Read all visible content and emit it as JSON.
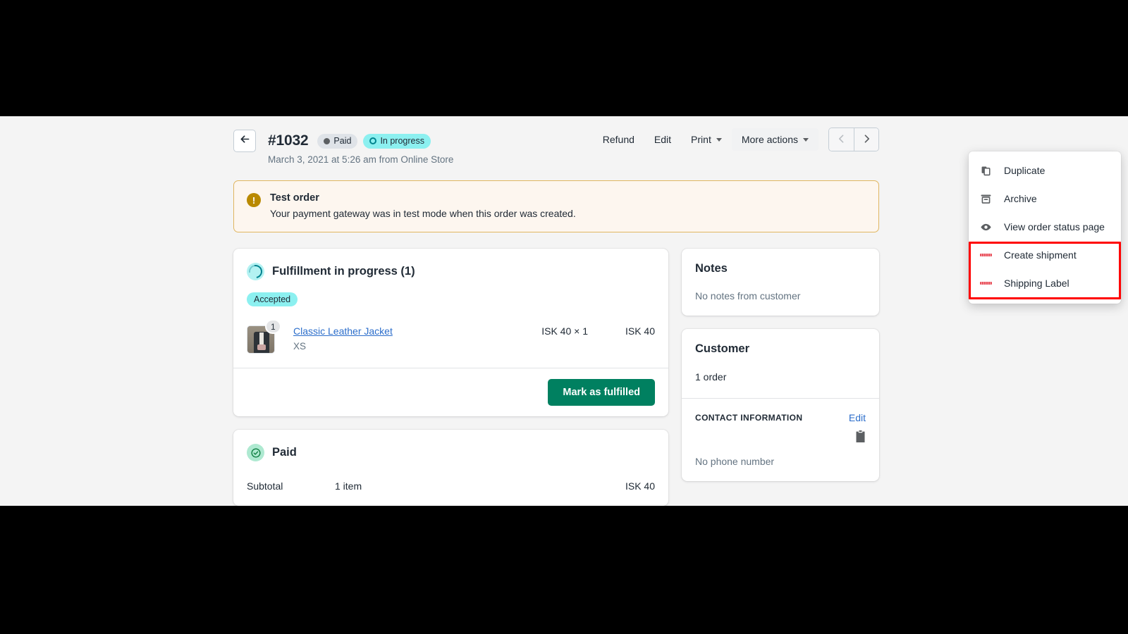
{
  "header": {
    "back_icon": "arrow-left-icon",
    "order_number": "#1032",
    "badges": [
      {
        "label": "Paid",
        "icon": "filled-circle-icon",
        "color": "#dfe3e8"
      },
      {
        "label": "In progress",
        "icon": "partial-ring-icon",
        "color": "#8cf0f0"
      }
    ],
    "date_line": "March 3, 2021 at 5:26 am from Online Store",
    "actions": {
      "refund": "Refund",
      "edit": "Edit",
      "print": "Print",
      "more_actions": "More actions"
    },
    "pagination": {
      "prev_icon": "chevron-left-icon",
      "next_icon": "chevron-right-icon"
    }
  },
  "more_actions_menu": {
    "items": [
      {
        "label": "Duplicate",
        "icon": "duplicate-icon"
      },
      {
        "label": "Archive",
        "icon": "archive-icon"
      },
      {
        "label": "View order status page",
        "icon": "eye-icon"
      },
      {
        "label": "Create shipment",
        "icon": "shipping-app-logo-icon"
      },
      {
        "label": "Shipping Label",
        "icon": "shipping-app-logo-icon"
      }
    ],
    "highlight_color": "#ff0000"
  },
  "banner": {
    "icon": "alert-exclamation-icon",
    "title": "Test order",
    "body": "Your payment gateway was in test mode when this order was created.",
    "border_color": "#e0b660",
    "background_color": "#fdf6ef"
  },
  "fulfillment_card": {
    "icon": "progress-ring-icon",
    "title": "Fulfillment in progress (1)",
    "status_chip": "Accepted",
    "line_item": {
      "thumbnail": "product-thumbnail-leather-jacket",
      "quantity_badge": "1",
      "product_name": "Classic Leather Jacket",
      "variant": "XS",
      "unit_price": "ISK 40 × 1",
      "line_total": "ISK 40"
    },
    "primary_button": "Mark as fulfilled"
  },
  "paid_card": {
    "icon": "check-circle-icon",
    "title": "Paid",
    "rows": [
      {
        "label": "Subtotal",
        "detail": "1 item",
        "amount": "ISK 40"
      }
    ]
  },
  "notes_card": {
    "title": "Notes",
    "empty_text": "No notes from customer"
  },
  "customer_card": {
    "title": "Customer",
    "order_count": "1 order",
    "contact_section": {
      "heading": "CONTACT INFORMATION",
      "edit_label": "Edit",
      "copy_icon": "clipboard-copy-icon",
      "phone": "No phone number"
    }
  }
}
